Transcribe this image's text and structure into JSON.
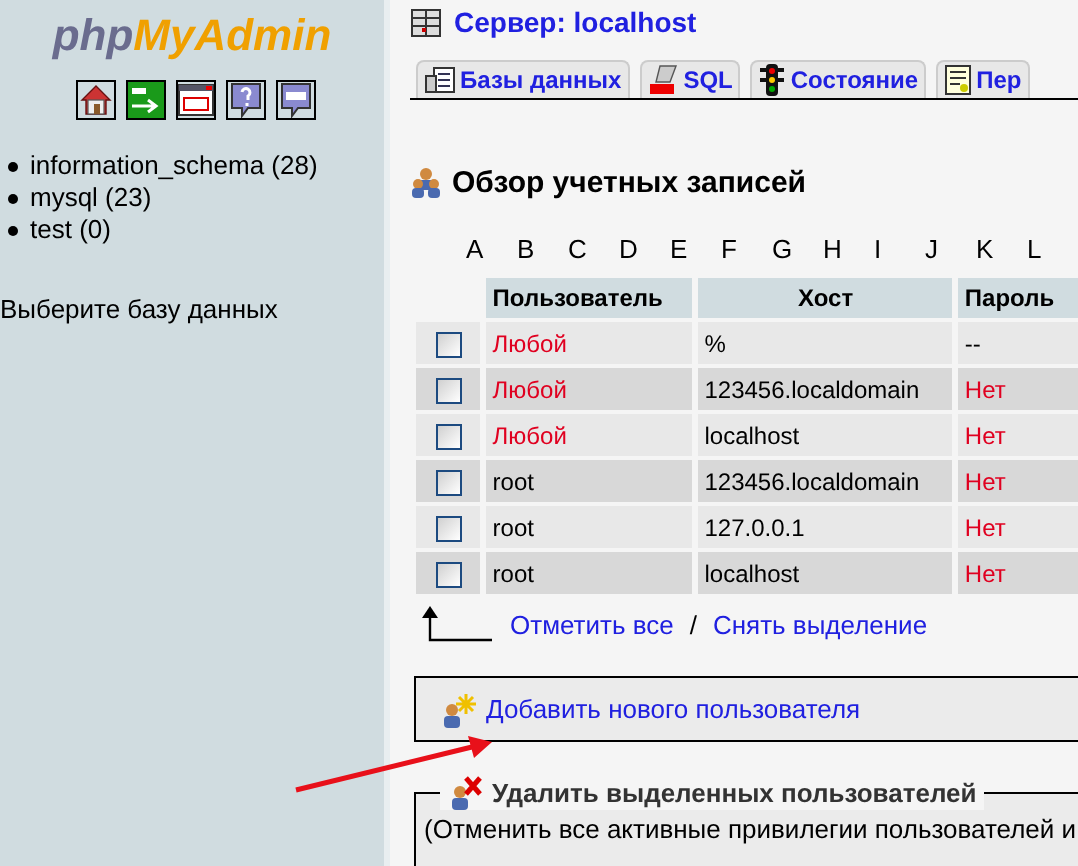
{
  "sidebar": {
    "logo": {
      "prefix": "php",
      "suffix": "MyAdmin"
    },
    "databases": [
      {
        "name": "information_schema (28)"
      },
      {
        "name": "mysql (23)"
      },
      {
        "name": "test (0)"
      }
    ],
    "hint": "Выберите базу данных"
  },
  "server": {
    "label": "Сервер: localhost"
  },
  "tabs": [
    {
      "label": "Базы данных",
      "kind": "databases"
    },
    {
      "label": "SQL",
      "kind": "sql"
    },
    {
      "label": "Состояние",
      "kind": "status"
    },
    {
      "label": "Пер",
      "kind": "vars"
    }
  ],
  "heading": "Обзор учетных записей",
  "letters": [
    "A",
    "B",
    "C",
    "D",
    "E",
    "F",
    "G",
    "H",
    "I",
    "J",
    "K",
    "L"
  ],
  "table": {
    "columns": [
      "Пользователь",
      "Хост",
      "Пароль"
    ],
    "rows": [
      {
        "checked": false,
        "user": {
          "text": "Любой",
          "kind": "any"
        },
        "host": "%",
        "password": {
          "text": "--",
          "kind": "placeholder"
        }
      },
      {
        "checked": false,
        "user": {
          "text": "Любой",
          "kind": "any"
        },
        "host": "123456.localdomain",
        "password": {
          "text": "Нет",
          "kind": "none"
        }
      },
      {
        "checked": false,
        "user": {
          "text": "Любой",
          "kind": "any"
        },
        "host": "localhost",
        "password": {
          "text": "Нет",
          "kind": "none"
        }
      },
      {
        "checked": false,
        "user": {
          "text": "root",
          "kind": "named"
        },
        "host": "123456.localdomain",
        "password": {
          "text": "Нет",
          "kind": "none"
        }
      },
      {
        "checked": false,
        "user": {
          "text": "root",
          "kind": "named"
        },
        "host": "127.0.0.1",
        "password": {
          "text": "Нет",
          "kind": "none"
        }
      },
      {
        "checked": false,
        "user": {
          "text": "root",
          "kind": "named"
        },
        "host": "localhost",
        "password": {
          "text": "Нет",
          "kind": "none"
        }
      }
    ]
  },
  "check_all": "Отметить все",
  "separator": "/",
  "uncheck_all": "Снять выделение",
  "add_user": "Добавить нового пользователя",
  "delete": {
    "legend": "Удалить выделенных пользователей",
    "note": "(Отменить все активные привилегии пользователей и"
  }
}
